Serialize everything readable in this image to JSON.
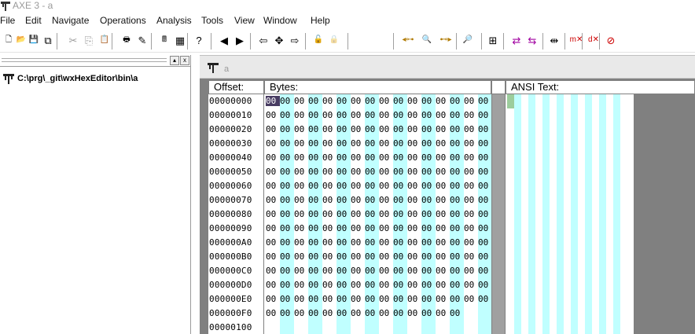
{
  "window": {
    "title": "AXE 3 - a"
  },
  "menu": [
    "File",
    "Edit",
    "Navigate",
    "Operations",
    "Analysis",
    "Tools",
    "View",
    "Window",
    "Help"
  ],
  "toolbar": {
    "highlight_color": "#ffff00",
    "buttons": [
      {
        "icon": "new-file-icon",
        "glyph": "🗋"
      },
      {
        "icon": "open-folder-icon",
        "glyph": "📂"
      },
      {
        "icon": "save-icon",
        "glyph": "💾"
      },
      {
        "icon": "save-all-icon",
        "glyph": "⧉"
      },
      {
        "icon": "cut-icon",
        "glyph": "✂"
      },
      {
        "icon": "copy-icon",
        "glyph": "⎘"
      },
      {
        "icon": "paste-icon",
        "glyph": "📋"
      },
      {
        "icon": "print-icon",
        "glyph": "🖶"
      },
      {
        "icon": "edit-pencil-icon",
        "glyph": "✎"
      },
      {
        "icon": "calculator-icon",
        "glyph": "🖩"
      },
      {
        "icon": "spreadsheet-icon",
        "glyph": "▦"
      },
      {
        "icon": "help-icon",
        "glyph": "?"
      },
      {
        "icon": "previous-icon",
        "glyph": "◀"
      },
      {
        "icon": "next-icon",
        "glyph": "▶"
      },
      {
        "icon": "go-back-icon",
        "glyph": "⇦"
      },
      {
        "icon": "fit-window-icon",
        "glyph": "✥"
      },
      {
        "icon": "go-forward-icon",
        "glyph": "⇨"
      },
      {
        "icon": "lock-open-icon",
        "glyph": "🔓"
      },
      {
        "icon": "lock-icon",
        "glyph": "🔒"
      },
      {
        "icon": "find-previous-icon",
        "glyph": "◂⊶"
      },
      {
        "icon": "find-icon",
        "glyph": "🔍"
      },
      {
        "icon": "find-next-icon",
        "glyph": "⊷▸"
      },
      {
        "icon": "find-green-icon",
        "glyph": "🔎"
      },
      {
        "icon": "structure-icon",
        "glyph": "⊞"
      },
      {
        "icon": "compare-icon",
        "glyph": "⇄"
      },
      {
        "icon": "compare-alt-icon",
        "glyph": "⇆"
      },
      {
        "icon": "split-icon",
        "glyph": "⇹"
      },
      {
        "icon": "mark-delete-icon",
        "glyph": "m✕"
      },
      {
        "icon": "delete-icon",
        "glyph": "d✕"
      },
      {
        "icon": "remove-icon",
        "glyph": "⊘"
      }
    ]
  },
  "left_panel": {
    "path": "C:\\prg\\_git\\wxHexEditor\\bin\\a",
    "pin_label": "▴",
    "close_label": "x"
  },
  "document": {
    "tab_name": "a"
  },
  "hex_view": {
    "headers": {
      "offset": "Offset:",
      "bytes": "Bytes:",
      "ansi": "ANSI Text:"
    },
    "offsets": [
      "00000000",
      "00000010",
      "00000020",
      "00000030",
      "00000040",
      "00000050",
      "00000060",
      "00000070",
      "00000080",
      "00000090",
      "000000A0",
      "000000B0",
      "000000C0",
      "000000D0",
      "000000E0",
      "000000F0",
      "00000100"
    ],
    "byte_value": "00",
    "full_rows": 15,
    "last_row_bytes": 14,
    "selected_byte": 0,
    "stripe_color": "#c0ffff",
    "selection_color": "#483c62"
  }
}
